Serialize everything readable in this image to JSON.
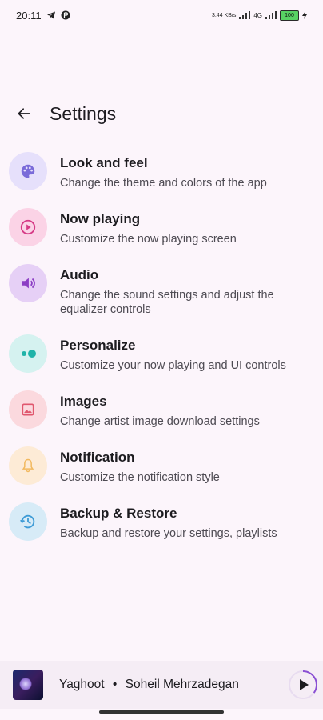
{
  "status": {
    "time": "20:11",
    "net_speed": "3.44 KB/s",
    "network_type": "4G",
    "battery": "100"
  },
  "header": {
    "title": "Settings"
  },
  "settings": [
    {
      "label": "Look and feel",
      "description": "Change the theme and colors of the app",
      "icon": "palette-icon",
      "bg": "#e6e0fb",
      "color": "#7a6bd9"
    },
    {
      "label": "Now playing",
      "description": "Customize the now playing screen",
      "icon": "play-circle-icon",
      "bg": "#fbd3e6",
      "color": "#d63a86"
    },
    {
      "label": "Audio",
      "description": "Change the sound settings and adjust the equalizer controls",
      "icon": "volume-icon",
      "bg": "#e6d0f6",
      "color": "#8c3fc4"
    },
    {
      "label": "Personalize",
      "description": "Customize your now playing and UI controls",
      "icon": "toggle-icon",
      "bg": "#d5f2f0",
      "color": "#1eb3a8"
    },
    {
      "label": "Images",
      "description": "Change artist image download settings",
      "icon": "image-icon",
      "bg": "#fbd9de",
      "color": "#e0576e"
    },
    {
      "label": "Notification",
      "description": "Customize the notification style",
      "icon": "bell-icon",
      "bg": "#fdebd6",
      "color": "#f2b95f"
    },
    {
      "label": "Backup & Restore",
      "description": "Backup and restore your settings, playlists",
      "icon": "history-icon",
      "bg": "#d7ebf7",
      "color": "#3e9bd6"
    }
  ],
  "player": {
    "title": "Yaghoot",
    "artist": "Soheil Mehrzadegan",
    "separator": "•",
    "progress": 0.35
  }
}
